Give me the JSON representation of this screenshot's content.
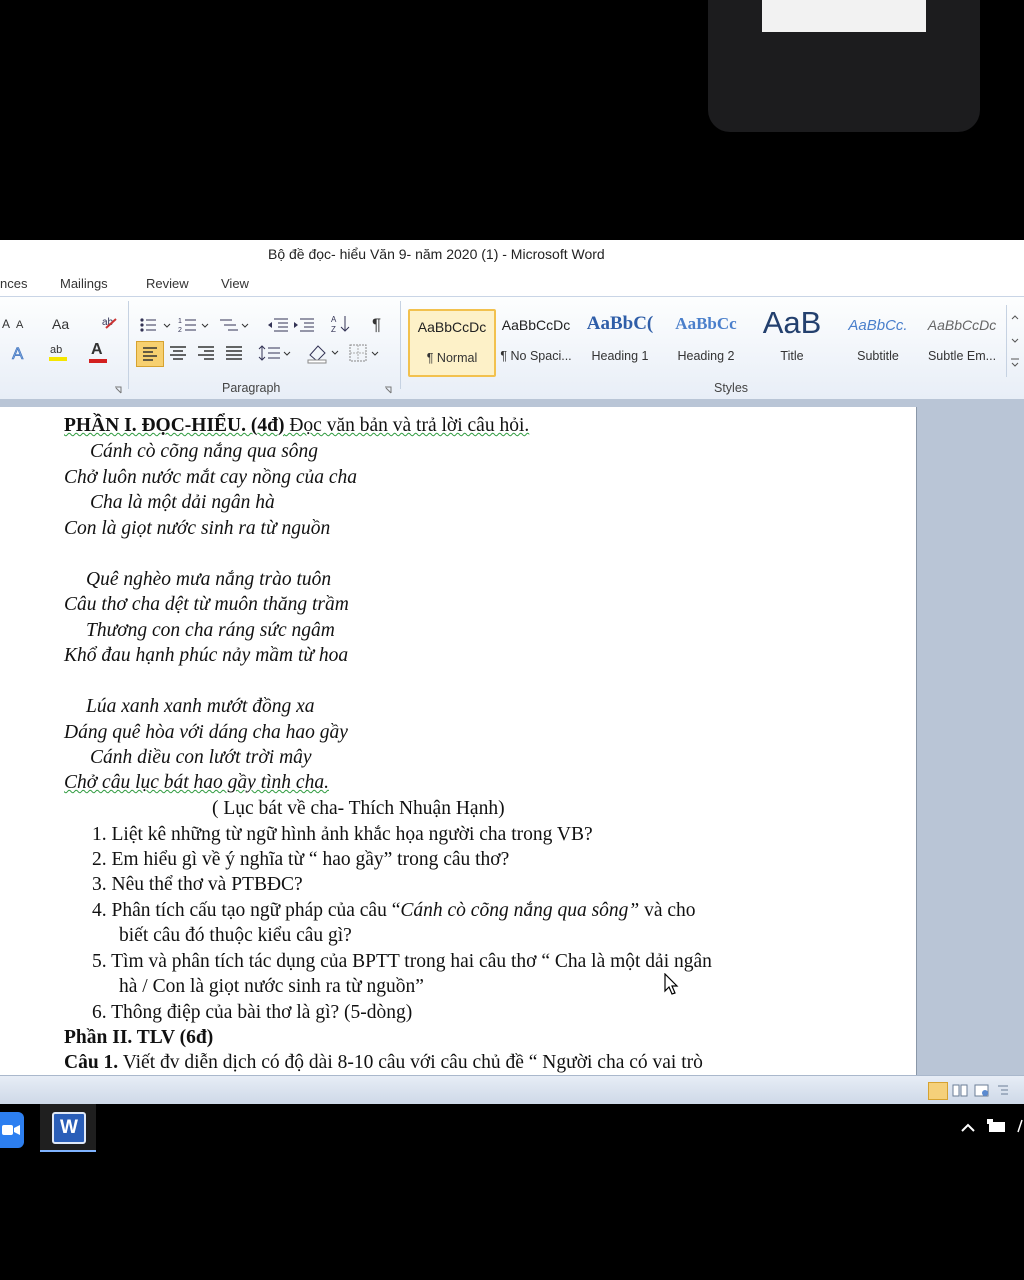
{
  "window_title": "Bộ đề đọc- hiểu Văn 9- năm 2020 (1)  -  Microsoft Word",
  "tabs": [
    "nces",
    "Mailings",
    "Review",
    "View"
  ],
  "ribbon": {
    "font_grow": "A",
    "font_shrink": "A",
    "change_case": "Aa",
    "font_color_letter": "A",
    "pilcrow": "¶",
    "paragraph_label": "Paragraph",
    "styles_label": "Styles"
  },
  "styles": [
    {
      "preview": "AaBbCcDc",
      "name": "¶ Normal"
    },
    {
      "preview": "AaBbCcDc",
      "name": "¶ No Spaci..."
    },
    {
      "preview": "AaBbC(",
      "name": "Heading 1"
    },
    {
      "preview": "AaBbCc",
      "name": "Heading 2"
    },
    {
      "preview": "AaB",
      "name": "Title"
    },
    {
      "preview": "AaBbCc.",
      "name": "Subtitle"
    },
    {
      "preview": "AaBbCcDc",
      "name": "Subtle Em..."
    }
  ],
  "document": {
    "heading": {
      "bold": "PHẦN I. ĐỌC-HIỂU. (4đ)",
      "rest": " Đọc văn bản và trả lời câu hỏi."
    },
    "poem": [
      "Cánh cò cõng nắng qua sông",
      "Chở luôn nước mắt cay nồng của cha",
      "Cha là một dải ngân hà",
      "Con là giọt nước sinh ra từ nguồn",
      "Quê nghèo mưa nắng trào tuôn",
      "Câu thơ cha dệt từ muôn thăng trầm",
      "Thương con cha ráng sức ngâm",
      "Khổ đau hạnh phúc nảy mầm từ hoa",
      "Lúa xanh xanh mướt đồng xa",
      "Dáng quê hòa với dáng cha hao gầy",
      "Cánh diều con lướt trời mây",
      "Chở câu lục bát hao gầy tình cha."
    ],
    "source": "( Lục bát về cha- Thích Nhuận Hạnh)",
    "questions": [
      "1.  Liệt kê những từ ngữ hình ảnh khắc họa người cha trong VB?",
      "2.  Em hiểu gì về ý nghĩa từ “ hao gầy” trong câu thơ?",
      "3.  Nêu thể thơ và PTBĐC?",
      "5.  Tìm và phân tích tác dụng của BPTT trong hai câu thơ “ Cha là một dải ngân",
      "hà / Con là giọt nước sinh ra từ nguồn”",
      "6.  Thông điệp của bài thơ là gì? (5-dòng)"
    ],
    "q4": {
      "lead": "4.  Phân tích cấu tạo ngữ pháp của câu “",
      "quote": "Cánh cò cõng nắng qua sông”",
      "tail": " và cho",
      "line2": "biết câu đó thuộc kiểu câu gì?"
    },
    "part2": "Phần II. TLV (6đ)",
    "cau1": {
      "bold": "Câu 1.",
      "rest": " Viết đv diễn dịch có độ dài 8-10 câu với câu chủ đề “ Người cha có vai trò"
    }
  },
  "taskbar": {
    "word_icon_letter": "W"
  }
}
